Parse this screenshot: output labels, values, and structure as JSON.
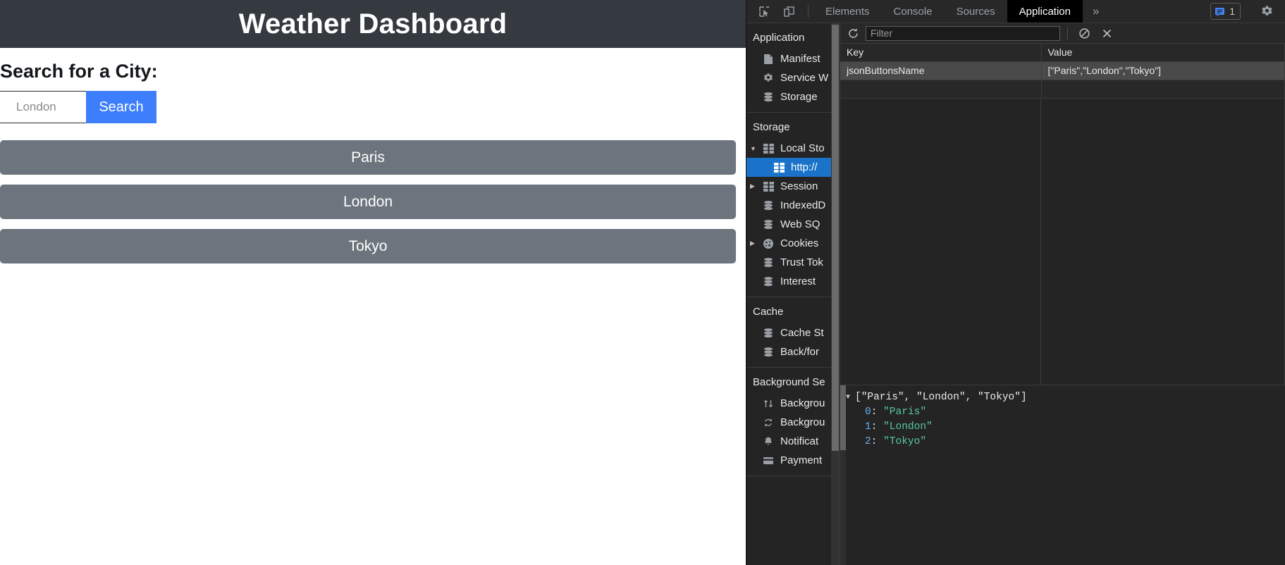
{
  "page": {
    "title": "Weather Dashboard",
    "search_label": "Search for a City:",
    "search_placeholder": "London",
    "search_button": "Search",
    "city_buttons": [
      "Paris",
      "London",
      "Tokyo"
    ],
    "colors": {
      "header_bg": "#343a40",
      "accent": "#3d7efc",
      "city_button_bg": "#6c757d"
    }
  },
  "devtools": {
    "toolbar": {
      "inspect_icon": "inspect-element-icon",
      "device_icon": "device-toolbar-icon",
      "tabs": [
        {
          "label": "Elements",
          "active": false
        },
        {
          "label": "Console",
          "active": false
        },
        {
          "label": "Sources",
          "active": false
        },
        {
          "label": "Application",
          "active": true
        }
      ],
      "more_tabs": "»",
      "issues_count": "1",
      "issues_icon": "issues-message-icon",
      "settings_icon": "gear-icon"
    },
    "sidebar": {
      "sections": [
        {
          "title": "Application",
          "items": [
            {
              "label": "Manifest",
              "icon": "manifest-document-icon",
              "arrow": "none",
              "selected": false,
              "child": false
            },
            {
              "label": "Service W",
              "icon": "gear-icon",
              "arrow": "none",
              "selected": false,
              "child": false
            },
            {
              "label": "Storage",
              "icon": "database-icon",
              "arrow": "none",
              "selected": false,
              "child": false
            }
          ]
        },
        {
          "title": "Storage",
          "items": [
            {
              "label": "Local Sto",
              "icon": "table-grid-icon",
              "arrow": "expanded",
              "selected": false,
              "child": false
            },
            {
              "label": "http://",
              "icon": "table-grid-icon",
              "arrow": "none",
              "selected": true,
              "child": true
            },
            {
              "label": "Session ",
              "icon": "table-grid-icon",
              "arrow": "collapsed",
              "selected": false,
              "child": false
            },
            {
              "label": "IndexedD",
              "icon": "database-icon",
              "arrow": "none",
              "selected": false,
              "child": false
            },
            {
              "label": "Web SQ",
              "icon": "database-icon",
              "arrow": "none",
              "selected": false,
              "child": false
            },
            {
              "label": "Cookies",
              "icon": "cookie-icon",
              "arrow": "collapsed",
              "selected": false,
              "child": false
            },
            {
              "label": "Trust Tok",
              "icon": "database-icon",
              "arrow": "none",
              "selected": false,
              "child": false
            },
            {
              "label": "Interest ",
              "icon": "database-icon",
              "arrow": "none",
              "selected": false,
              "child": false
            }
          ]
        },
        {
          "title": "Cache",
          "items": [
            {
              "label": "Cache St",
              "icon": "database-icon",
              "arrow": "none",
              "selected": false,
              "child": false
            },
            {
              "label": "Back/for",
              "icon": "database-icon",
              "arrow": "none",
              "selected": false,
              "child": false
            }
          ]
        },
        {
          "title": "Background Se",
          "items": [
            {
              "label": "Backgrou",
              "icon": "transfer-arrows-icon",
              "arrow": "none",
              "selected": false,
              "child": false
            },
            {
              "label": "Backgrou",
              "icon": "sync-arrows-icon",
              "arrow": "none",
              "selected": false,
              "child": false
            },
            {
              "label": "Notificat",
              "icon": "bell-icon",
              "arrow": "none",
              "selected": false,
              "child": false
            },
            {
              "label": "Payment",
              "icon": "payment-card-icon",
              "arrow": "none",
              "selected": false,
              "child": false
            }
          ]
        }
      ]
    },
    "filterbar": {
      "refresh_icon": "refresh-icon",
      "filter_placeholder": "Filter",
      "clear_all_icon": "clear-all-no-entry-icon",
      "delete_selected_icon": "close-x-icon"
    },
    "table": {
      "columns": [
        "Key",
        "Value"
      ],
      "rows": [
        {
          "key": "jsonButtonsName",
          "value": "[\"Paris\",\"London\",\"Tokyo\"]",
          "selected": true
        }
      ]
    },
    "preview": {
      "expand_arrow": "▼",
      "summary": "[\"Paris\", \"London\", \"Tokyo\"]",
      "entries": [
        {
          "index": "0",
          "colon": ": ",
          "value": "\"Paris\""
        },
        {
          "index": "1",
          "colon": ": ",
          "value": "\"London\""
        },
        {
          "index": "2",
          "colon": ": ",
          "value": "\"Tokyo\""
        }
      ]
    }
  }
}
